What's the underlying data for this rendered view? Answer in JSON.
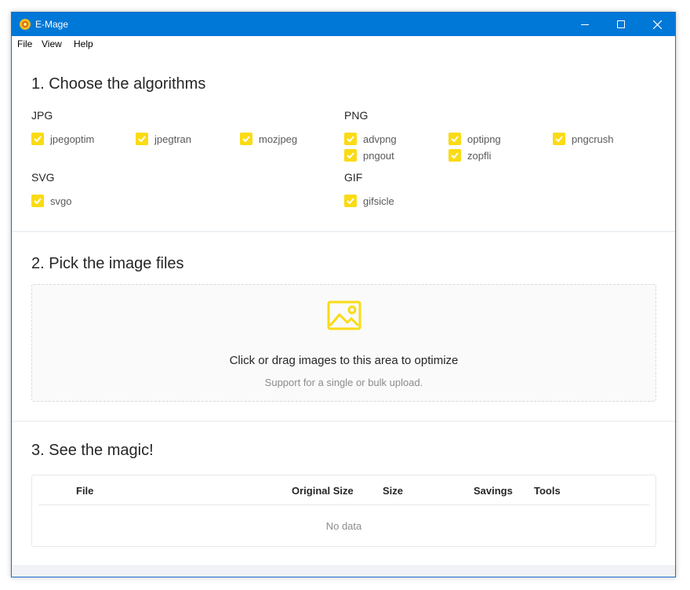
{
  "window": {
    "title": "E-Mage"
  },
  "menu": [
    "File",
    "View",
    "Help"
  ],
  "section1": {
    "title": "1. Choose the algorithms",
    "groups": {
      "jpg": {
        "label": "JPG",
        "items": [
          "jpegoptim",
          "jpegtran",
          "mozjpeg"
        ]
      },
      "png": {
        "label": "PNG",
        "items": [
          "advpng",
          "optipng",
          "pngcrush",
          "pngout",
          "zopfli"
        ]
      },
      "svg": {
        "label": "SVG",
        "items": [
          "svgo"
        ]
      },
      "gif": {
        "label": "GIF",
        "items": [
          "gifsicle"
        ]
      }
    },
    "checkbox_color": "#fadb14"
  },
  "section2": {
    "title": "2. Pick the image files",
    "drop_text": "Click or drag images to this area to optimize",
    "drop_hint": "Support for a single or bulk upload.",
    "icon": "picture-icon"
  },
  "section3": {
    "title": "3. See the magic!",
    "columns": [
      "File",
      "Original Size",
      "Size",
      "Savings",
      "Tools"
    ],
    "empty_text": "No data"
  },
  "colors": {
    "titlebar": "#0078d7",
    "accent": "#fadb14"
  }
}
